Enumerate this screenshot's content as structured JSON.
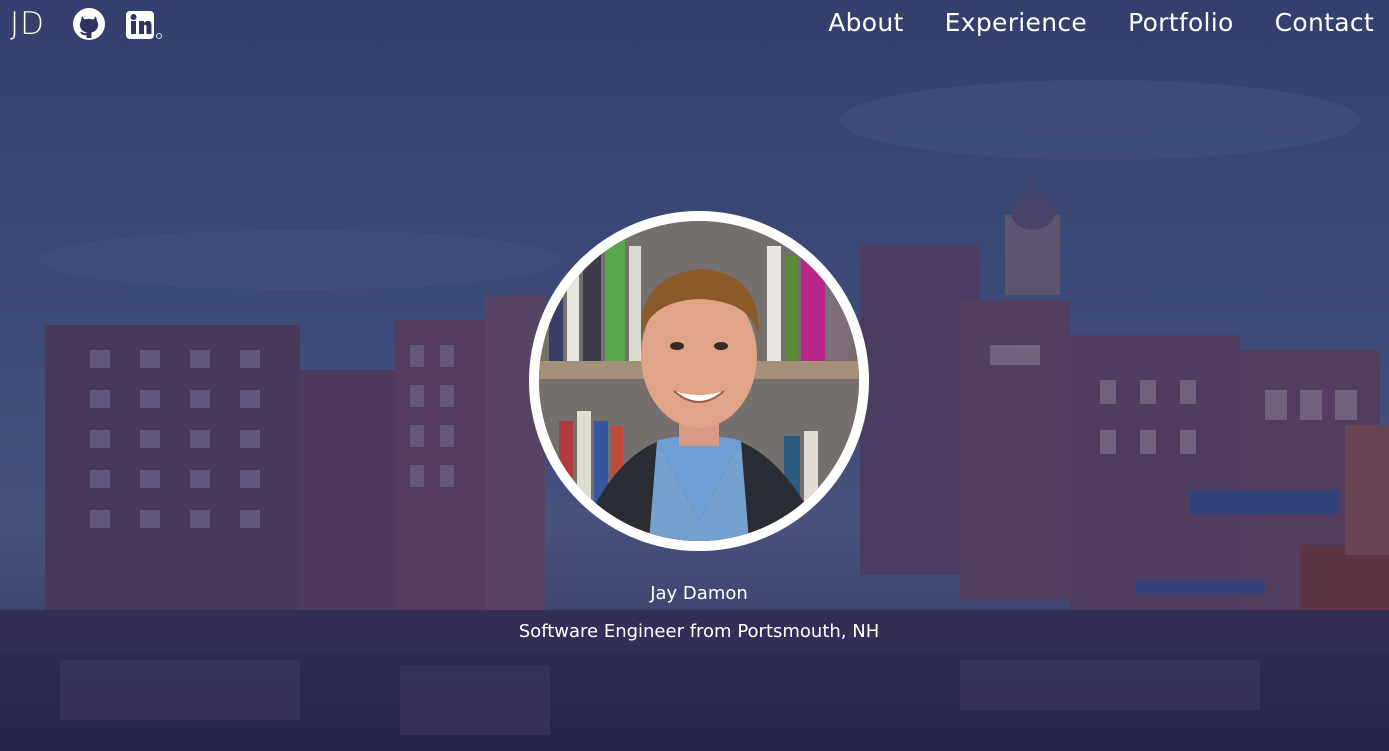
{
  "header": {
    "logo_text": "JD",
    "social": [
      {
        "icon": "github-icon"
      },
      {
        "icon": "linkedin-icon"
      }
    ],
    "nav": [
      {
        "label": "About"
      },
      {
        "label": "Experience"
      },
      {
        "label": "Portfolio"
      },
      {
        "label": "Contact"
      }
    ]
  },
  "hero": {
    "name": "Jay Damon",
    "tagline": "Software Engineer from Portsmouth, NH",
    "background": "harbor-waterfront-dusk",
    "avatar": "profile-photo"
  },
  "colors": {
    "overlay": "#2c3055",
    "text": "#ffffff",
    "avatar_border": "#ffffff"
  }
}
